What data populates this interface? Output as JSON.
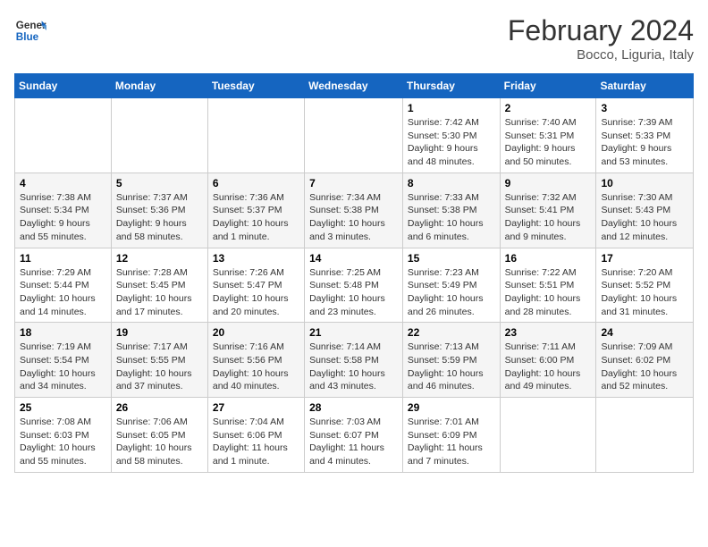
{
  "logo": {
    "line1": "General",
    "line2": "Blue"
  },
  "title": "February 2024",
  "subtitle": "Bocco, Liguria, Italy",
  "weekdays": [
    "Sunday",
    "Monday",
    "Tuesday",
    "Wednesday",
    "Thursday",
    "Friday",
    "Saturday"
  ],
  "weeks": [
    [
      {
        "day": "",
        "info": ""
      },
      {
        "day": "",
        "info": ""
      },
      {
        "day": "",
        "info": ""
      },
      {
        "day": "",
        "info": ""
      },
      {
        "day": "1",
        "info": "Sunrise: 7:42 AM\nSunset: 5:30 PM\nDaylight: 9 hours and 48 minutes."
      },
      {
        "day": "2",
        "info": "Sunrise: 7:40 AM\nSunset: 5:31 PM\nDaylight: 9 hours and 50 minutes."
      },
      {
        "day": "3",
        "info": "Sunrise: 7:39 AM\nSunset: 5:33 PM\nDaylight: 9 hours and 53 minutes."
      }
    ],
    [
      {
        "day": "4",
        "info": "Sunrise: 7:38 AM\nSunset: 5:34 PM\nDaylight: 9 hours and 55 minutes."
      },
      {
        "day": "5",
        "info": "Sunrise: 7:37 AM\nSunset: 5:36 PM\nDaylight: 9 hours and 58 minutes."
      },
      {
        "day": "6",
        "info": "Sunrise: 7:36 AM\nSunset: 5:37 PM\nDaylight: 10 hours and 1 minute."
      },
      {
        "day": "7",
        "info": "Sunrise: 7:34 AM\nSunset: 5:38 PM\nDaylight: 10 hours and 3 minutes."
      },
      {
        "day": "8",
        "info": "Sunrise: 7:33 AM\nSunset: 5:38 PM\nDaylight: 10 hours and 6 minutes."
      },
      {
        "day": "9",
        "info": "Sunrise: 7:32 AM\nSunset: 5:41 PM\nDaylight: 10 hours and 9 minutes."
      },
      {
        "day": "10",
        "info": "Sunrise: 7:30 AM\nSunset: 5:43 PM\nDaylight: 10 hours and 12 minutes."
      }
    ],
    [
      {
        "day": "11",
        "info": "Sunrise: 7:29 AM\nSunset: 5:44 PM\nDaylight: 10 hours and 14 minutes."
      },
      {
        "day": "12",
        "info": "Sunrise: 7:28 AM\nSunset: 5:45 PM\nDaylight: 10 hours and 17 minutes."
      },
      {
        "day": "13",
        "info": "Sunrise: 7:26 AM\nSunset: 5:47 PM\nDaylight: 10 hours and 20 minutes."
      },
      {
        "day": "14",
        "info": "Sunrise: 7:25 AM\nSunset: 5:48 PM\nDaylight: 10 hours and 23 minutes."
      },
      {
        "day": "15",
        "info": "Sunrise: 7:23 AM\nSunset: 5:49 PM\nDaylight: 10 hours and 26 minutes."
      },
      {
        "day": "16",
        "info": "Sunrise: 7:22 AM\nSunset: 5:51 PM\nDaylight: 10 hours and 28 minutes."
      },
      {
        "day": "17",
        "info": "Sunrise: 7:20 AM\nSunset: 5:52 PM\nDaylight: 10 hours and 31 minutes."
      }
    ],
    [
      {
        "day": "18",
        "info": "Sunrise: 7:19 AM\nSunset: 5:54 PM\nDaylight: 10 hours and 34 minutes."
      },
      {
        "day": "19",
        "info": "Sunrise: 7:17 AM\nSunset: 5:55 PM\nDaylight: 10 hours and 37 minutes."
      },
      {
        "day": "20",
        "info": "Sunrise: 7:16 AM\nSunset: 5:56 PM\nDaylight: 10 hours and 40 minutes."
      },
      {
        "day": "21",
        "info": "Sunrise: 7:14 AM\nSunset: 5:58 PM\nDaylight: 10 hours and 43 minutes."
      },
      {
        "day": "22",
        "info": "Sunrise: 7:13 AM\nSunset: 5:59 PM\nDaylight: 10 hours and 46 minutes."
      },
      {
        "day": "23",
        "info": "Sunrise: 7:11 AM\nSunset: 6:00 PM\nDaylight: 10 hours and 49 minutes."
      },
      {
        "day": "24",
        "info": "Sunrise: 7:09 AM\nSunset: 6:02 PM\nDaylight: 10 hours and 52 minutes."
      }
    ],
    [
      {
        "day": "25",
        "info": "Sunrise: 7:08 AM\nSunset: 6:03 PM\nDaylight: 10 hours and 55 minutes."
      },
      {
        "day": "26",
        "info": "Sunrise: 7:06 AM\nSunset: 6:05 PM\nDaylight: 10 hours and 58 minutes."
      },
      {
        "day": "27",
        "info": "Sunrise: 7:04 AM\nSunset: 6:06 PM\nDaylight: 11 hours and 1 minute."
      },
      {
        "day": "28",
        "info": "Sunrise: 7:03 AM\nSunset: 6:07 PM\nDaylight: 11 hours and 4 minutes."
      },
      {
        "day": "29",
        "info": "Sunrise: 7:01 AM\nSunset: 6:09 PM\nDaylight: 11 hours and 7 minutes."
      },
      {
        "day": "",
        "info": ""
      },
      {
        "day": "",
        "info": ""
      }
    ]
  ]
}
